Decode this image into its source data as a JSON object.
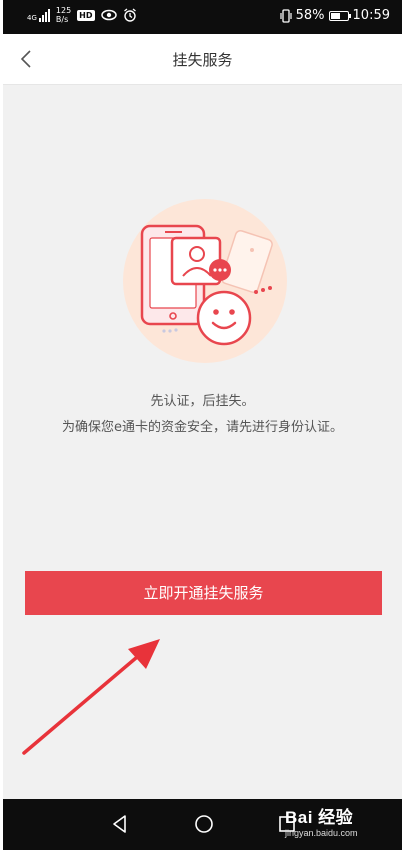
{
  "status_bar": {
    "network_type": "4G",
    "net_speed_value": "125",
    "net_speed_unit": "B/s",
    "hd_badge": "HD",
    "battery_percent": "58%",
    "battery_level": 0.58,
    "time": "10:59"
  },
  "header": {
    "back_icon": "chevron-left-icon",
    "title": "挂失服务"
  },
  "main": {
    "illustration_icon": "phone-smiley-illustration",
    "tip_line1": "先认证，后挂失。",
    "tip_line2": "为确保您e通卡的资金安全，请先进行身份认证。",
    "action_button": "立即开通挂失服务"
  },
  "annotation": {
    "arrow_color": "#e8333a"
  },
  "nav_bar": {
    "back_icon": "triangle-back-icon",
    "home_icon": "circle-home-icon",
    "recents_icon": "square-recents-icon"
  },
  "watermark": {
    "brand": "Bai 经验",
    "url": "jingyan.baidu.com"
  },
  "colors": {
    "accent": "#e8464e",
    "background": "#f1f1f1",
    "illustration_circle": "#fde6d8"
  }
}
